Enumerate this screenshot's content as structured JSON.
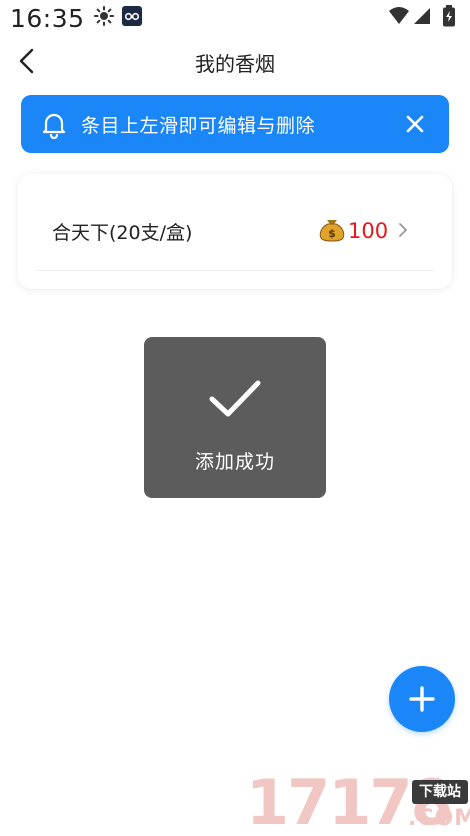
{
  "status_bar": {
    "time": "16:35"
  },
  "nav": {
    "title": "我的香烟"
  },
  "tip": {
    "text": "条目上左滑即可编辑与删除"
  },
  "list": {
    "items": [
      {
        "name": "合天下(20支/盒)",
        "price": "100"
      }
    ]
  },
  "toast": {
    "text": "添加成功"
  },
  "watermark": {
    "digits": "17178",
    "badge": "下载站",
    "suffix": ".COM"
  },
  "colors": {
    "accent": "#1a86f8",
    "price": "#e8161b",
    "toast_bg": "#464646"
  },
  "icons": {
    "back": "chevron-left-icon",
    "bell": "bell-icon",
    "close": "close-icon",
    "money": "money-bag-icon",
    "chevron": "chevron-right-icon",
    "check": "check-icon",
    "add": "plus-icon"
  }
}
